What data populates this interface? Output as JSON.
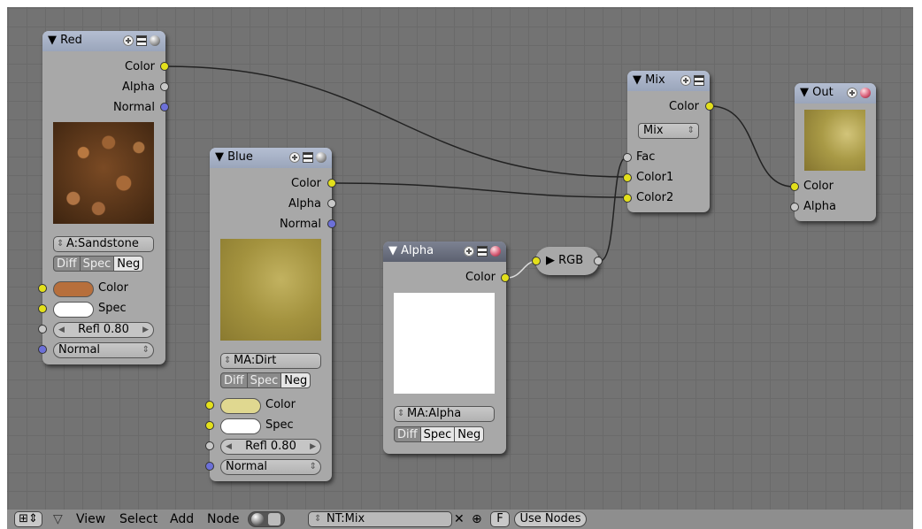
{
  "nodes": {
    "red": {
      "title": "Red",
      "outputs": [
        "Color",
        "Alpha",
        "Normal"
      ],
      "texture": "A:Sandstone",
      "tabs": [
        "Diff",
        "Spec",
        "Neg"
      ],
      "inputs": {
        "color": "Color",
        "spec": "Spec",
        "refl": "Refl 0.80",
        "normal": "Normal"
      },
      "swatch_color": "#b76f3c"
    },
    "blue": {
      "title": "Blue",
      "outputs": [
        "Color",
        "Alpha",
        "Normal"
      ],
      "texture": "MA:Dirt",
      "tabs": [
        "Diff",
        "Spec",
        "Neg"
      ],
      "inputs": {
        "color": "Color",
        "spec": "Spec",
        "refl": "Refl 0.80",
        "normal": "Normal"
      },
      "swatch_color": "#e0d890"
    },
    "alpha": {
      "title": "Alpha",
      "output": "Color",
      "texture": "MA:Alpha",
      "tabs": [
        "Diff",
        "Spec",
        "Neg"
      ]
    },
    "rgb": {
      "label": "RGB"
    },
    "mix": {
      "title": "Mix",
      "output": "Color",
      "blend_mode": "Mix",
      "inputs": [
        "Fac",
        "Color1",
        "Color2"
      ]
    },
    "out": {
      "title": "Out",
      "inputs": [
        "Color",
        "Alpha"
      ]
    }
  },
  "toolbar": {
    "menus": [
      "View",
      "Select",
      "Add",
      "Node"
    ],
    "tree_name": "NT:Mix",
    "fake_user": "F",
    "use_nodes": "Use Nodes"
  }
}
